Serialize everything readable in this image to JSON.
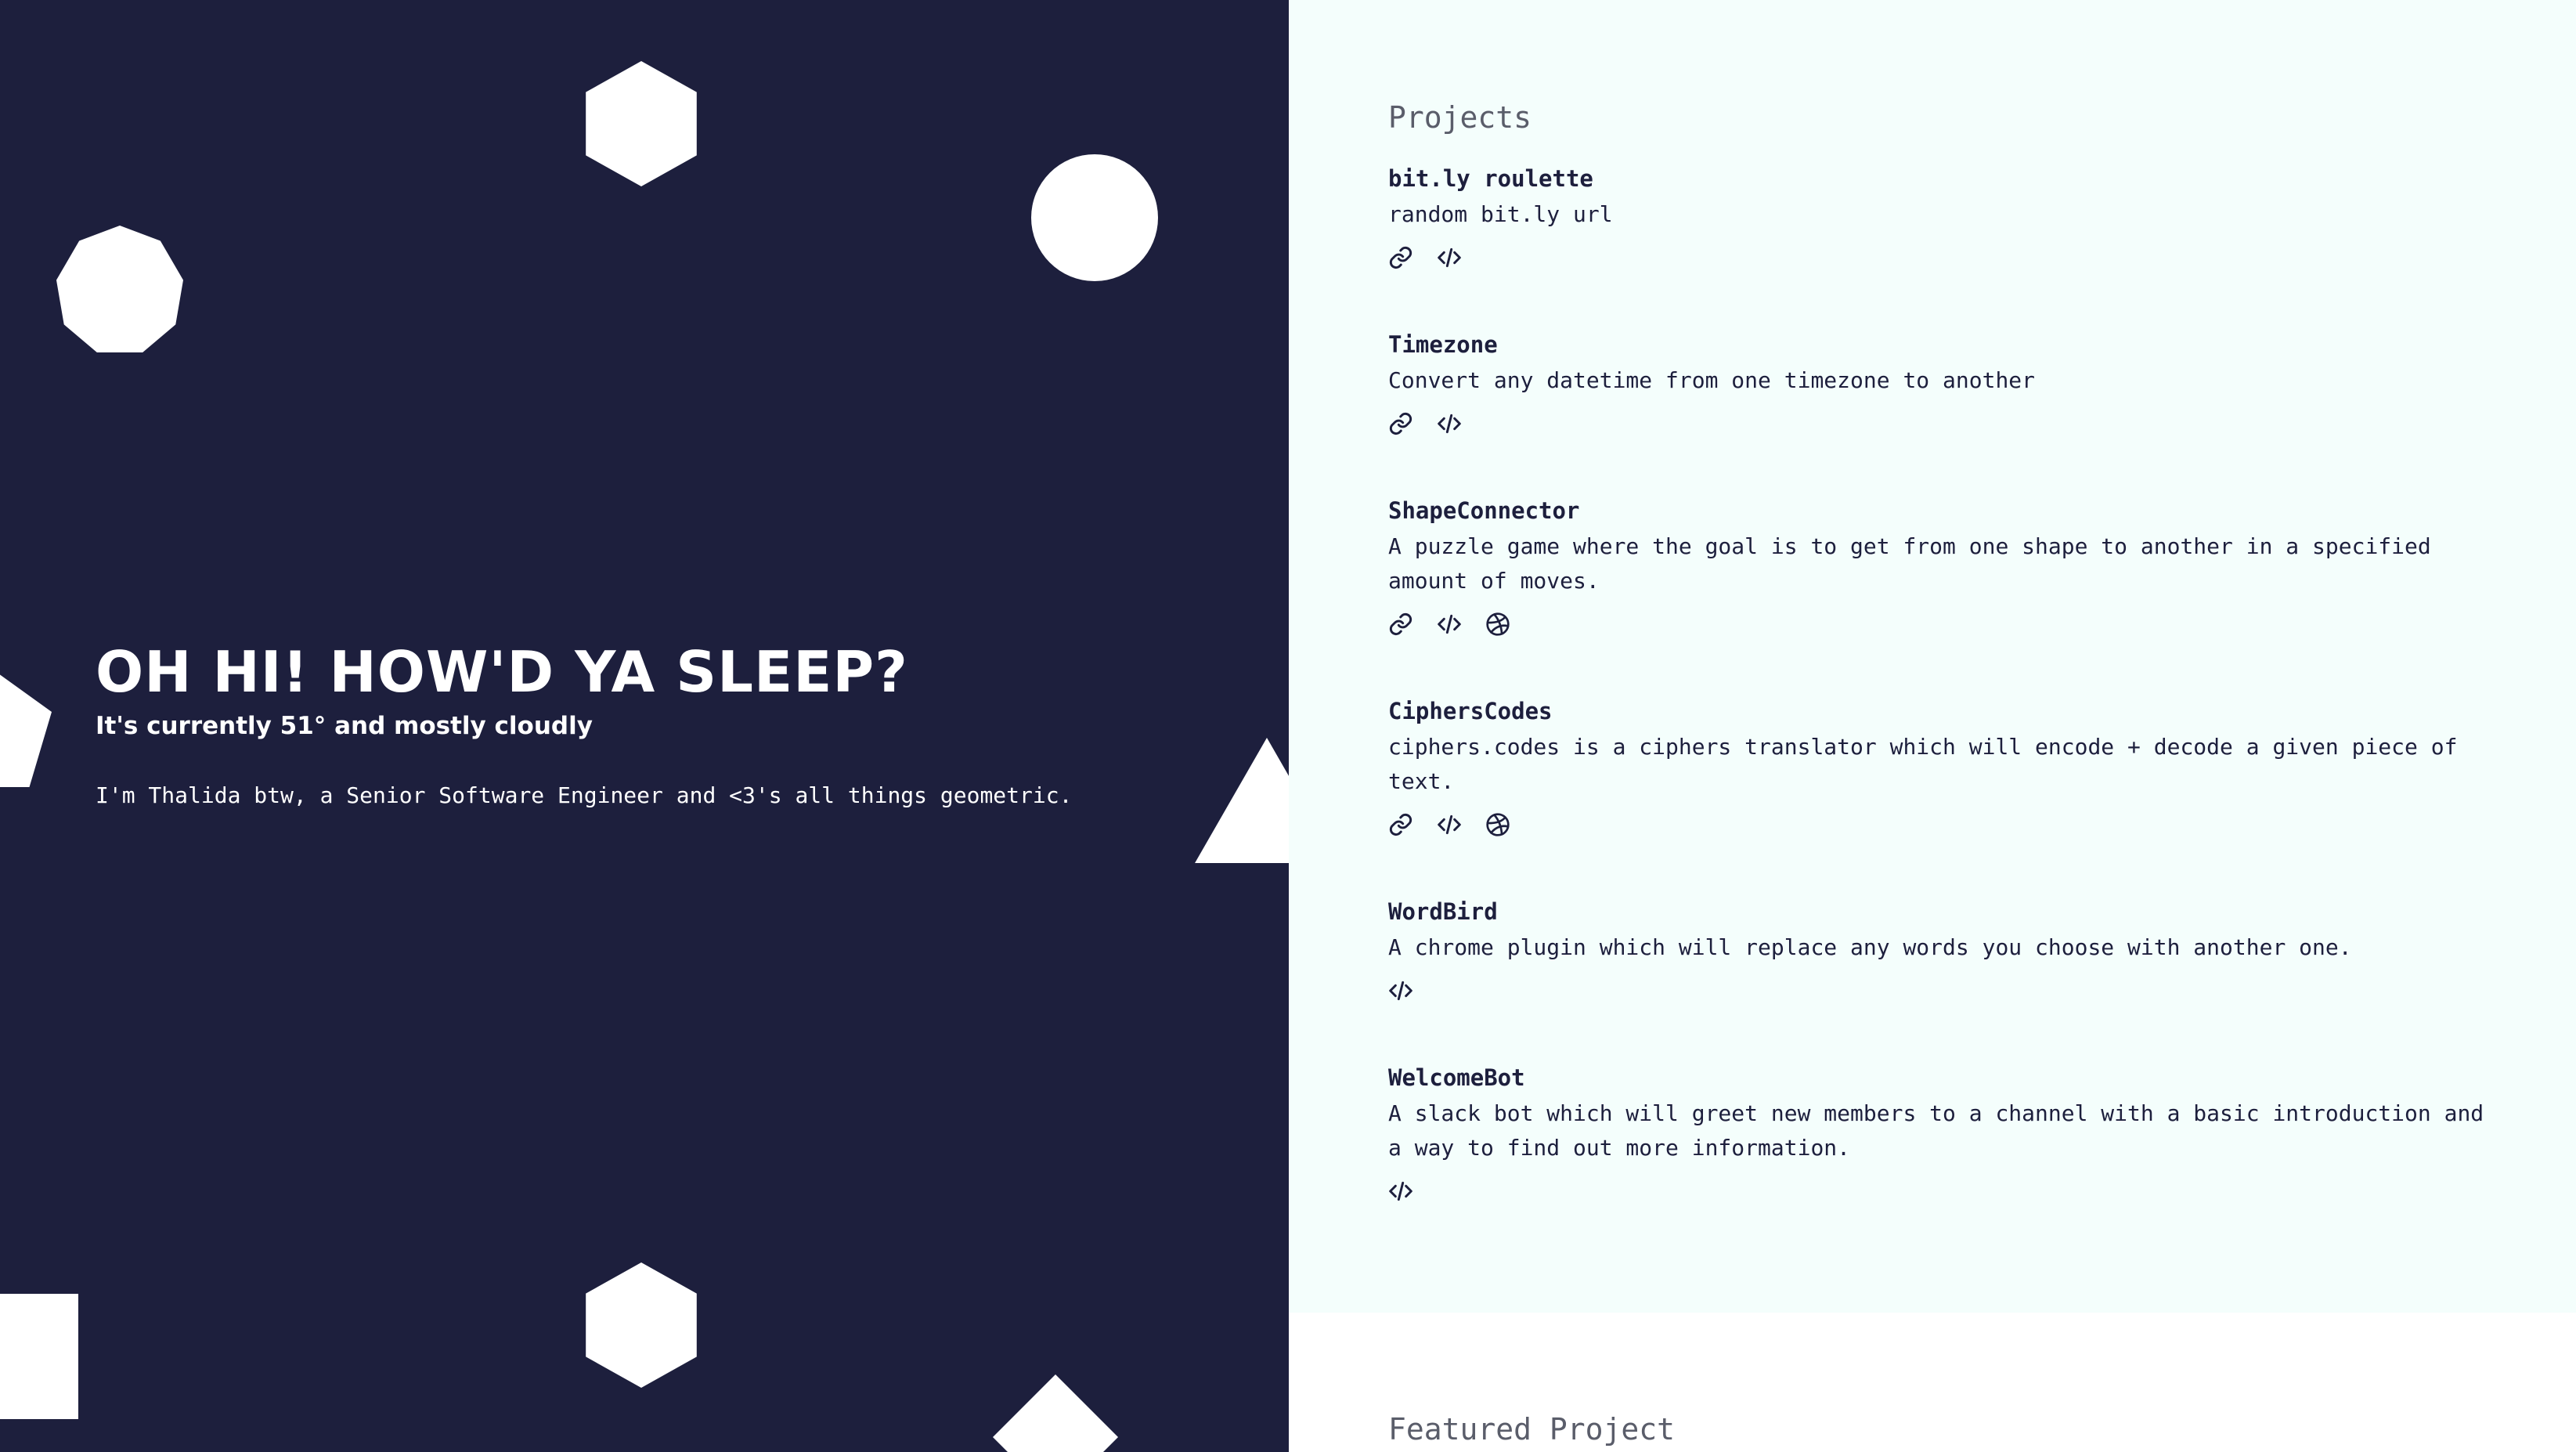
{
  "hero": {
    "greeting": "OH HI! HOW'D YA SLEEP?",
    "weather": "It's currently 51° and mostly cloudly",
    "intro": "I'm Thalida btw, a Senior Software Engineer and <3's all things geometric."
  },
  "shapes": [
    "hexagon",
    "circle",
    "octagon",
    "pentagon",
    "triangle",
    "square",
    "hexagon",
    "diamond"
  ],
  "sections": {
    "projects_title": "Projects",
    "featured_title": "Featured Project"
  },
  "projects": [
    {
      "title": "bit.ly roulette",
      "desc": "random bit.ly url",
      "links": [
        "link-icon",
        "code-icon"
      ]
    },
    {
      "title": "Timezone",
      "desc": "Convert any datetime from one timezone to another",
      "links": [
        "link-icon",
        "code-icon"
      ]
    },
    {
      "title": "ShapeConnector",
      "desc": "A puzzle game where the goal is to get from one shape to another in a specified amount of moves.",
      "links": [
        "link-icon",
        "code-icon",
        "dribbble-icon"
      ]
    },
    {
      "title": "CiphersCodes",
      "desc": "ciphers.codes is a ciphers translator which will encode + decode a given piece of text.",
      "links": [
        "link-icon",
        "code-icon",
        "dribbble-icon"
      ]
    },
    {
      "title": "WordBird",
      "desc": "A chrome plugin which will replace any words you choose with another one.",
      "links": [
        "code-icon"
      ]
    },
    {
      "title": "WelcomeBot",
      "desc": "A slack bot which will greet new members to a channel with a basic introduction and a way to find out more information.",
      "links": [
        "code-icon"
      ]
    }
  ],
  "colors": {
    "navy": "#1d1f3d",
    "projects_bg": "#f4fefc",
    "white": "#ffffff"
  }
}
